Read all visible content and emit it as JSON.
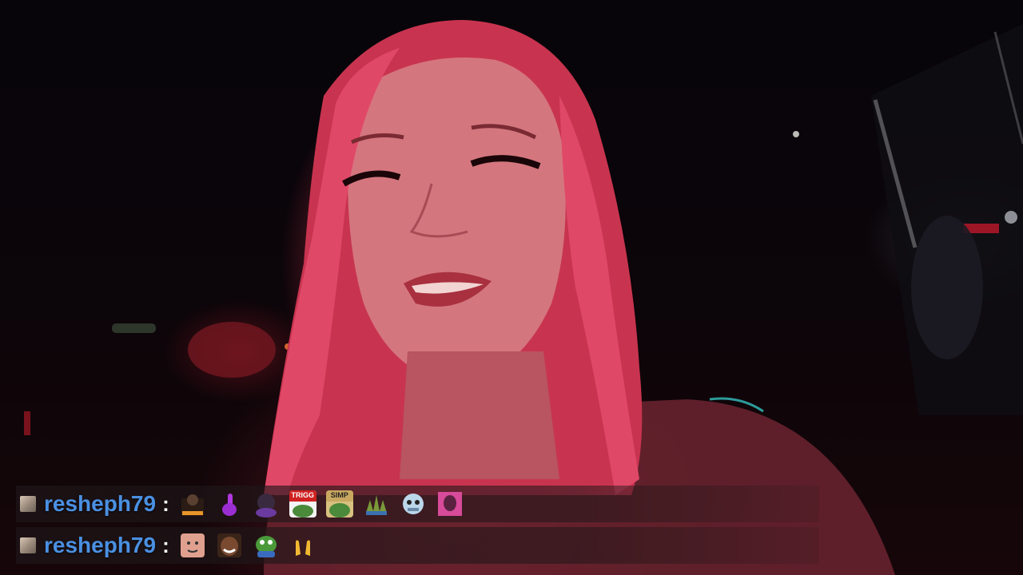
{
  "stream": {
    "scene": "video-feed"
  },
  "chat": {
    "messages": [
      {
        "username": "resheph79",
        "separator": ":",
        "emotes": [
          "subscriber-emote",
          "finger-emote",
          "dark-head-emote",
          "trigg-emote",
          "simp-emote",
          "spiky-emote",
          "robot-emote",
          "pink-portrait-emote"
        ],
        "emote_texts": {
          "trigg": "TRIGG",
          "simp": "SIMP"
        }
      },
      {
        "username": "resheph79",
        "separator": ":",
        "emotes": [
          "face-emote",
          "smiling-man-emote",
          "peepo-emote",
          "clap-hands-emote"
        ]
      }
    ]
  },
  "colors": {
    "username": "#4a90e2",
    "hair": "#d43a5e",
    "background": "#050306"
  }
}
